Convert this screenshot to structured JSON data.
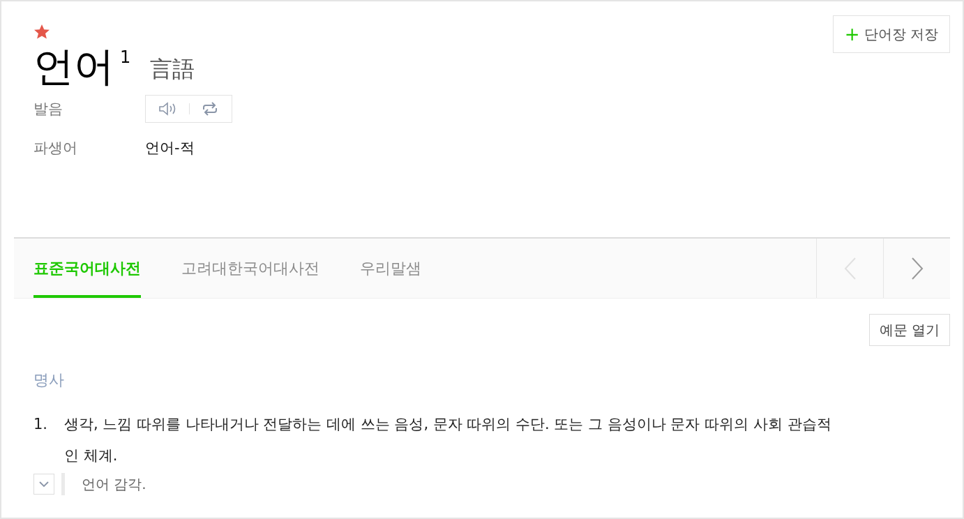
{
  "entry": {
    "word": "언어",
    "homonym": "1",
    "hanja": "言語"
  },
  "save_button": {
    "icon": "+",
    "label": "단어장 저장"
  },
  "info_rows": [
    {
      "kind": "pronunciation",
      "label": "발음"
    },
    {
      "kind": "text",
      "label": "파생어",
      "value": "언어-적"
    }
  ],
  "tabs": [
    {
      "label": "표준국어대사전",
      "selected": true
    },
    {
      "label": "고려대한국어대사전",
      "selected": false
    },
    {
      "label": "우리말샘",
      "selected": false
    }
  ],
  "tab_nav": [
    {
      "kind": "prev",
      "disabled": true
    },
    {
      "kind": "next",
      "disabled": false
    }
  ],
  "examples_button": "예문 열기",
  "part_of_speech": "명사",
  "definitions": [
    {
      "number": "1.",
      "text": "생각, 느낌 따위를 나타내거나 전달하는 데에 쓰는 음성, 문자 따위의 수단. 또는 그 음성이나 문자 따위의 사회 관습적인 체계.",
      "examples": [
        {
          "text": "언어 감각.",
          "expanded": false
        }
      ]
    }
  ]
}
